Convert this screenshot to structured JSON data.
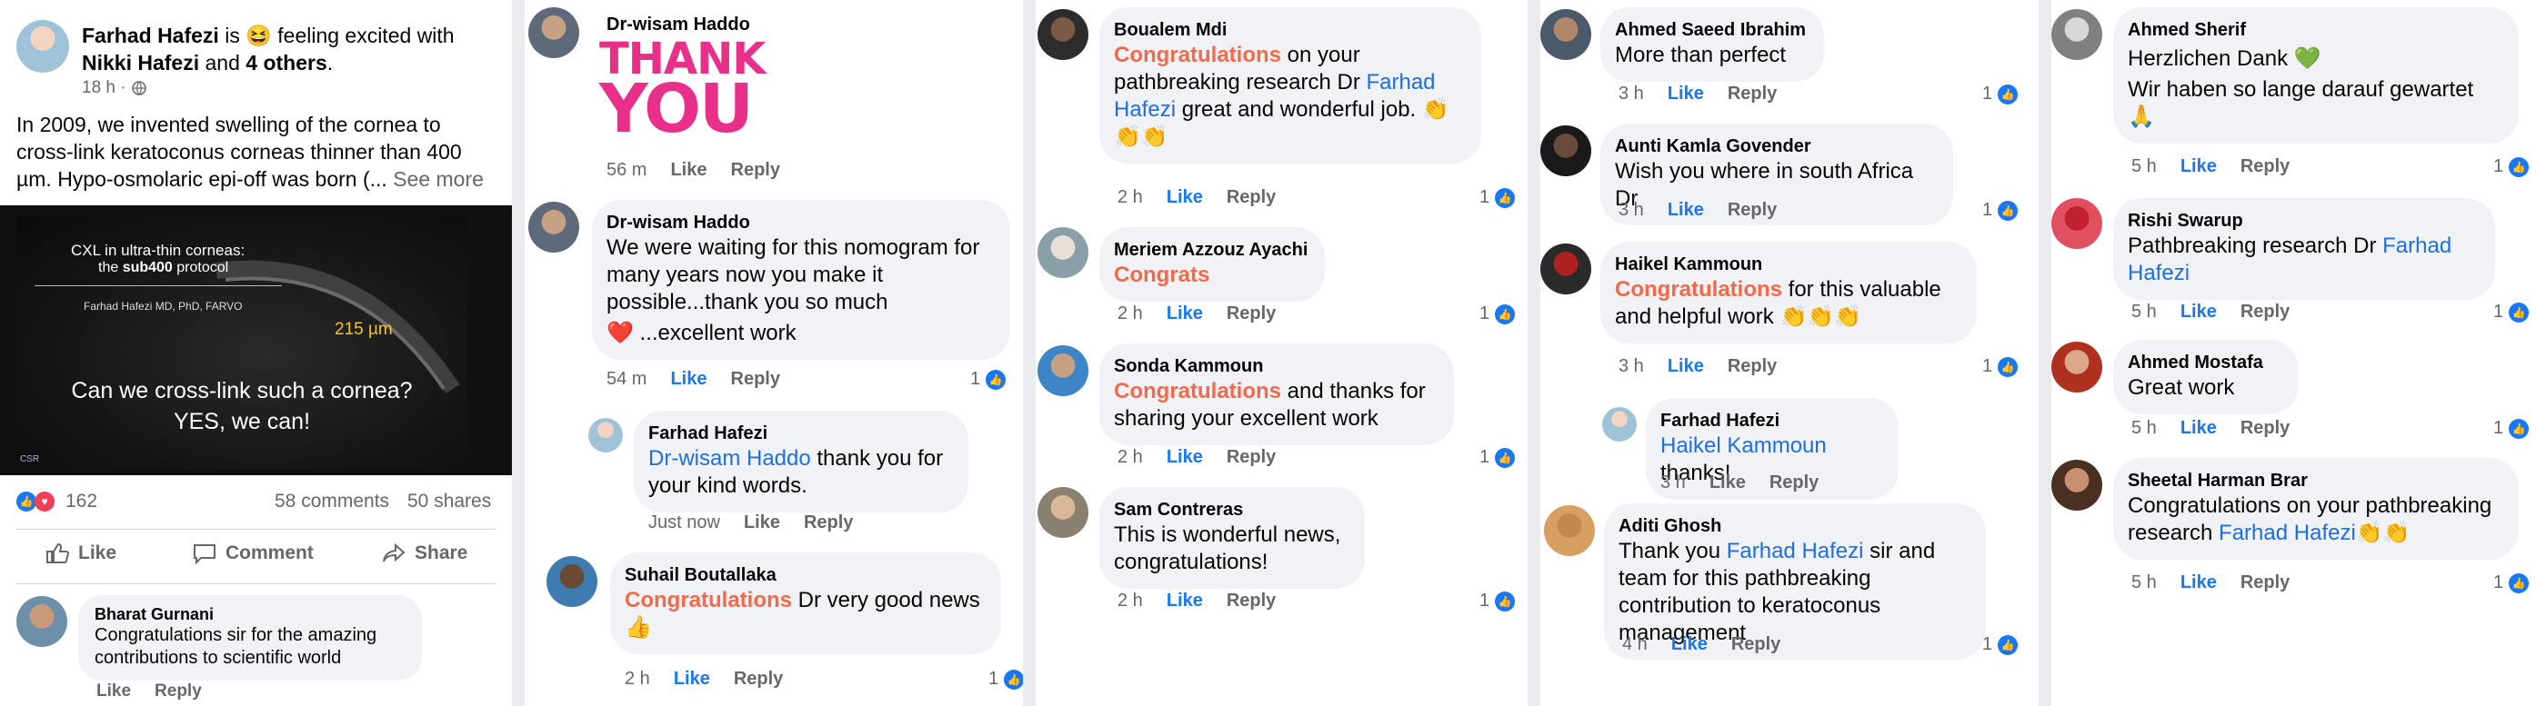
{
  "post": {
    "author": "Farhad Hafezi",
    "is_text": "is",
    "feeling_emoji": "😆",
    "feeling_text": "feeling excited with",
    "tagged_name": "Nikki Hafezi",
    "and_text": "and",
    "others": "4 others",
    "time": "18 h ·",
    "body": "In 2009, we invented swelling of the cornea to cross-link keratoconus corneas thinner than 400 µm. Hypo-osmolaric epi-off was born (...",
    "see_more": "See more",
    "image": {
      "title1": "CXL in ultra-thin corneas:",
      "title2a": "the ",
      "title2b": "sub400",
      "title2c": " protocol",
      "credit": "Farhad Hafezi MD, PhD, FARVO",
      "measure": "215 µm",
      "q1": "Can we cross-link such a cornea?",
      "q2": "YES, we can!",
      "logo": "CSR"
    },
    "reactions_count": "162",
    "comments": "58 comments",
    "shares": "50 shares",
    "like_btn": "Like",
    "comment_btn": "Comment",
    "share_btn": "Share",
    "first_comment": {
      "author": "Bharat Gurnani",
      "text": "Congratulations sir for the amazing contributions to scientific world",
      "like": "Like",
      "reply": "Reply"
    }
  },
  "col2": [
    {
      "author": "Dr-wisam Haddo",
      "sticker1": "THANK",
      "sticker2": "YOU",
      "time": "56 m",
      "like": "Like",
      "reply": "Reply"
    },
    {
      "author": "Dr-wisam Haddo",
      "text1": "We were waiting for this nomogram for many years now you make it possible...thank you so much",
      "text2": "❤️ ...excellent work",
      "time": "54 m",
      "like": "Like",
      "reply": "Reply",
      "count": "1"
    },
    {
      "author": "Farhad Hafezi",
      "mention": "Dr-wisam Haddo",
      "text": " thank you for your kind words.",
      "time": "Just now",
      "like": "Like",
      "reply": "Reply"
    },
    {
      "author": "Suhail Boutallaka",
      "hl": "Congratulations",
      "text": " Dr very good news",
      "emoji": "👍",
      "time": "2 h",
      "like": "Like",
      "reply": "Reply",
      "count": "1"
    }
  ],
  "col3": [
    {
      "author": "Boualem Mdi",
      "hl": "Congratulations",
      "text1": " on your pathbreaking research Dr ",
      "mention": "Farhad Hafezi",
      "text2": " great and wonderful job. 👏👏👏",
      "time": "2 h",
      "like": "Like",
      "reply": "Reply",
      "count": "1"
    },
    {
      "author": "Meriem Azzouz Ayachi",
      "hl": "Congrats",
      "time": "2 h",
      "like": "Like",
      "reply": "Reply",
      "count": "1"
    },
    {
      "author": "Sonda Kammoun",
      "hl": "Congratulations",
      "text": " and thanks for sharing your excellent work",
      "time": "2 h",
      "like": "Like",
      "reply": "Reply",
      "count": "1"
    },
    {
      "author": "Sam Contreras",
      "text": "This is wonderful news, congratulations!",
      "time": "2 h",
      "like": "Like",
      "reply": "Reply",
      "count": "1"
    }
  ],
  "col4": [
    {
      "author": "Ahmed Saeed Ibrahim",
      "text": "More than perfect",
      "time": "3 h",
      "like": "Like",
      "reply": "Reply",
      "count": "1"
    },
    {
      "author": "Aunti Kamla Govender",
      "text": "Wish you where in south Africa Dr",
      "time": "3 h",
      "like": "Like",
      "reply": "Reply",
      "count": "1"
    },
    {
      "author": "Haikel Kammoun",
      "hl": "Congratulations",
      "text": " for this valuable and helpful work  👏👏👏",
      "time": "3 h",
      "like": "Like",
      "reply": "Reply",
      "count": "1"
    },
    {
      "author": "Farhad Hafezi",
      "mention": "Haikel Kammoun",
      "text": " thanks!",
      "time": "3 h",
      "like": "Like",
      "reply": "Reply"
    },
    {
      "author": "Aditi Ghosh",
      "text1": "Thank you ",
      "mention": "Farhad Hafezi",
      "text2": " sir and team for this pathbreaking contribution to keratoconus management",
      "time": "4 h",
      "like": "Like",
      "reply": "Reply",
      "count": "1"
    }
  ],
  "col5": [
    {
      "author": "Ahmed Sherif",
      "text1": "Herzlichen Dank 💚",
      "text2": "Wir haben so lange darauf gewartet 🙏",
      "time": "5 h",
      "like": "Like",
      "reply": "Reply",
      "count": "1"
    },
    {
      "author": "Rishi Swarup",
      "text": "Pathbreaking research Dr ",
      "mention": "Farhad Hafezi",
      "time": "5 h",
      "like": "Like",
      "reply": "Reply",
      "count": "1"
    },
    {
      "author": "Ahmed Mostafa",
      "text": "Great work",
      "time": "5 h",
      "like": "Like",
      "reply": "Reply",
      "count": "1"
    },
    {
      "author": "Sheetal Harman Brar",
      "text": "Congratulations on your pathbreaking research ",
      "mention": "Farhad Hafezi",
      "emoji": "👏👏",
      "time": "5 h",
      "like": "Like",
      "reply": "Reply",
      "count": "1"
    }
  ],
  "colors": {
    "accent": "#1877f2",
    "highlight": "#f3694b",
    "bubble": "#f0f2f5",
    "muted": "#65676b"
  }
}
